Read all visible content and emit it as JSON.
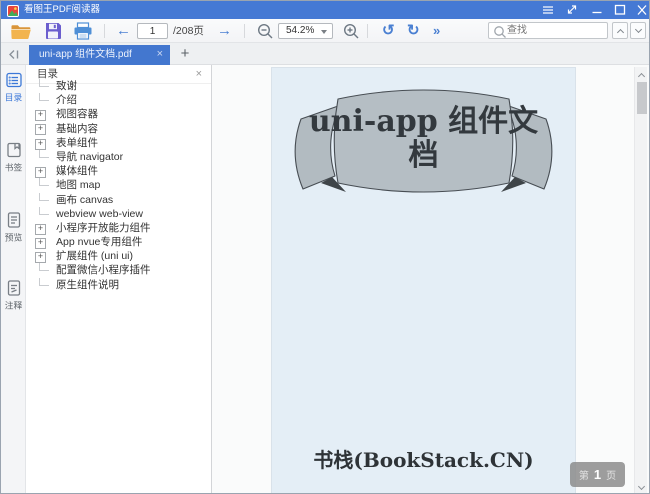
{
  "titlebar": {
    "title": "看图王PDF阅读器"
  },
  "toolbar": {
    "page_input": "1",
    "page_total": "/208页",
    "zoom_level": "54.2%",
    "search_placeholder": "查找"
  },
  "icons": {
    "back_arrow": "←",
    "forward_arrow": "→",
    "rotate_left": "↺",
    "rotate_right": "↻",
    "more": "»",
    "close": "×",
    "new_tab": "+"
  },
  "tabbar": {
    "active_tab": "uni-app 组件文档.pdf"
  },
  "sidebar": {
    "items": [
      {
        "label": "目录",
        "active": true
      },
      {
        "label": "书签",
        "active": false
      },
      {
        "label": "预览",
        "active": false
      },
      {
        "label": "注释",
        "active": false
      }
    ]
  },
  "toc": {
    "header": "目录",
    "items": [
      {
        "label": "致谢",
        "expandable": false
      },
      {
        "label": "介绍",
        "expandable": false
      },
      {
        "label": "视图容器",
        "expandable": true
      },
      {
        "label": "基础内容",
        "expandable": true
      },
      {
        "label": "表单组件",
        "expandable": true
      },
      {
        "label": "导航 navigator",
        "expandable": false
      },
      {
        "label": "媒体组件",
        "expandable": true
      },
      {
        "label": "地图 map",
        "expandable": false
      },
      {
        "label": "画布 canvas",
        "expandable": false
      },
      {
        "label": "webview web-view",
        "expandable": false
      },
      {
        "label": "小程序开放能力组件",
        "expandable": true
      },
      {
        "label": "App nvue专用组件",
        "expandable": true
      },
      {
        "label": "扩展组件 (uni ui)",
        "expandable": true
      },
      {
        "label": "配置微信小程序插件",
        "expandable": false
      },
      {
        "label": "原生组件说明",
        "expandable": false
      }
    ]
  },
  "document": {
    "banner_title_line1": "uni-app 组件文",
    "banner_title_line2": "档",
    "footer": "书栈(BookStack.CN)"
  },
  "page_badge": {
    "prefix": "第",
    "number": "1",
    "suffix": "页"
  },
  "colors": {
    "titlebar_blue": "#4579d4",
    "tab_blue": "#4377cf",
    "page_bg": "#e4eef6",
    "ribbon_gray": "#b2bbc1"
  }
}
